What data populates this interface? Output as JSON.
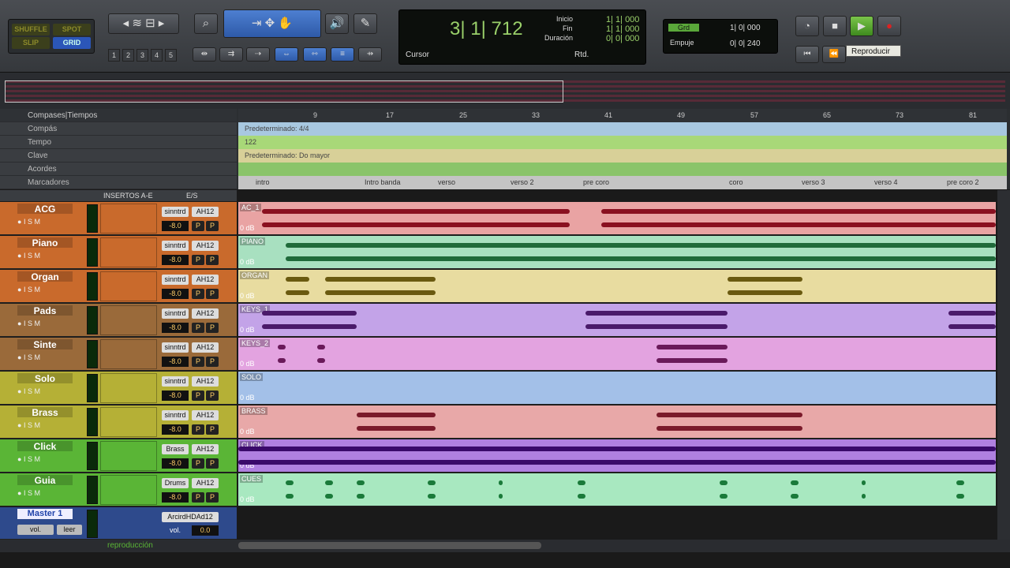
{
  "toolbar": {
    "modes": [
      "SHUFFLE",
      "SPOT",
      "SLIP",
      "GRID"
    ],
    "zoom_presets": [
      "1",
      "2",
      "3",
      "4",
      "5"
    ],
    "counter": {
      "main": "3| 1| 712",
      "sublabel": "Cursor",
      "inicio_label": "Inicio",
      "fin_label": "Fin",
      "duracion_label": "Duración",
      "inicio": "1| 1| 000",
      "fin": "1| 1| 000",
      "duracion": "0| 0| 000",
      "rtd": "Rtd."
    },
    "grid": {
      "grid_label": "Grd",
      "grid_value": "1| 0| 000",
      "nudge_label": "Empuje",
      "nudge_value": "0| 0| 240"
    },
    "tooltip": "Reproducir"
  },
  "rulers": {
    "header": "Compases|Tiempos",
    "rows": [
      "Compás",
      "Tempo",
      "Clave",
      "Acordes",
      "Marcadores"
    ],
    "bar_ticks": [
      "9",
      "17",
      "25",
      "33",
      "41",
      "49",
      "57",
      "65",
      "73",
      "81"
    ],
    "meter_text": "Predeterminado: 4/4",
    "tempo_text": "122",
    "key_text": "Predeterminado: Do mayor",
    "markers": [
      "intro",
      "Intro banda",
      "verso",
      "verso 2",
      "pre coro",
      "coro",
      "verso 3",
      "verso 4",
      "pre coro 2"
    ]
  },
  "mixer_header": {
    "inserts": "INSERTOS A-E",
    "io": "E/S"
  },
  "tracks": [
    {
      "name": "ACG",
      "input": "sinntrd",
      "output": "AH12",
      "vol": "-8.0",
      "clip": "AC_1",
      "color": "#e9a3a3",
      "header": "#c96a2c",
      "wave": "#8a1020"
    },
    {
      "name": "Piano",
      "input": "sinntrd",
      "output": "AH12",
      "vol": "-8.0",
      "clip": "PIANO",
      "color": "#a8e0c0",
      "header": "#c96a2c",
      "wave": "#1f6a3a"
    },
    {
      "name": "Organ",
      "input": "sinntrd",
      "output": "AH12",
      "vol": "-8.0",
      "clip": "ORGAN",
      "color": "#e8dca0",
      "header": "#c96a2c",
      "wave": "#6a5a10"
    },
    {
      "name": "Pads",
      "input": "sinntrd",
      "output": "AH12",
      "vol": "-8.0",
      "clip": "KEYS_1",
      "color": "#c3a3e8",
      "header": "#9a6a3a",
      "wave": "#4a1a6a"
    },
    {
      "name": "Sinte",
      "input": "sinntrd",
      "output": "AH12",
      "vol": "-8.0",
      "clip": "KEYS_2",
      "color": "#e3a3e0",
      "header": "#9a6a3a",
      "wave": "#6a1a5a"
    },
    {
      "name": "Solo",
      "input": "sinntrd",
      "output": "AH12",
      "vol": "-8.0",
      "clip": "SOLO",
      "color": "#a3c0e8",
      "header": "#b5b036",
      "wave": "#1a3a6a"
    },
    {
      "name": "Brass",
      "input": "sinntrd",
      "output": "AH12",
      "vol": "-8.0",
      "clip": "BRASS",
      "color": "#e8a8a8",
      "header": "#b5b036",
      "wave": "#7a1a2a"
    },
    {
      "name": "Click",
      "input": "Brass",
      "output": "AH12",
      "vol": "-8.0",
      "clip": "CLICK",
      "color": "#b080e0",
      "header": "#5ab536",
      "wave": "#3a0a6a"
    },
    {
      "name": "Guia",
      "input": "Drums",
      "output": "AH12",
      "vol": "-8.0",
      "clip": "CUES",
      "color": "#a8e8c0",
      "header": "#5ab536",
      "wave": "#1a7a3a"
    }
  ],
  "master": {
    "name": "Master 1",
    "output": "ArcirdHDAd12",
    "vol_label": "vol.",
    "vol": "0.0",
    "mode": "leer",
    "vol_mode": "vol."
  },
  "bottom": {
    "label": "reproducción"
  },
  "clip_vol": "0 dB"
}
